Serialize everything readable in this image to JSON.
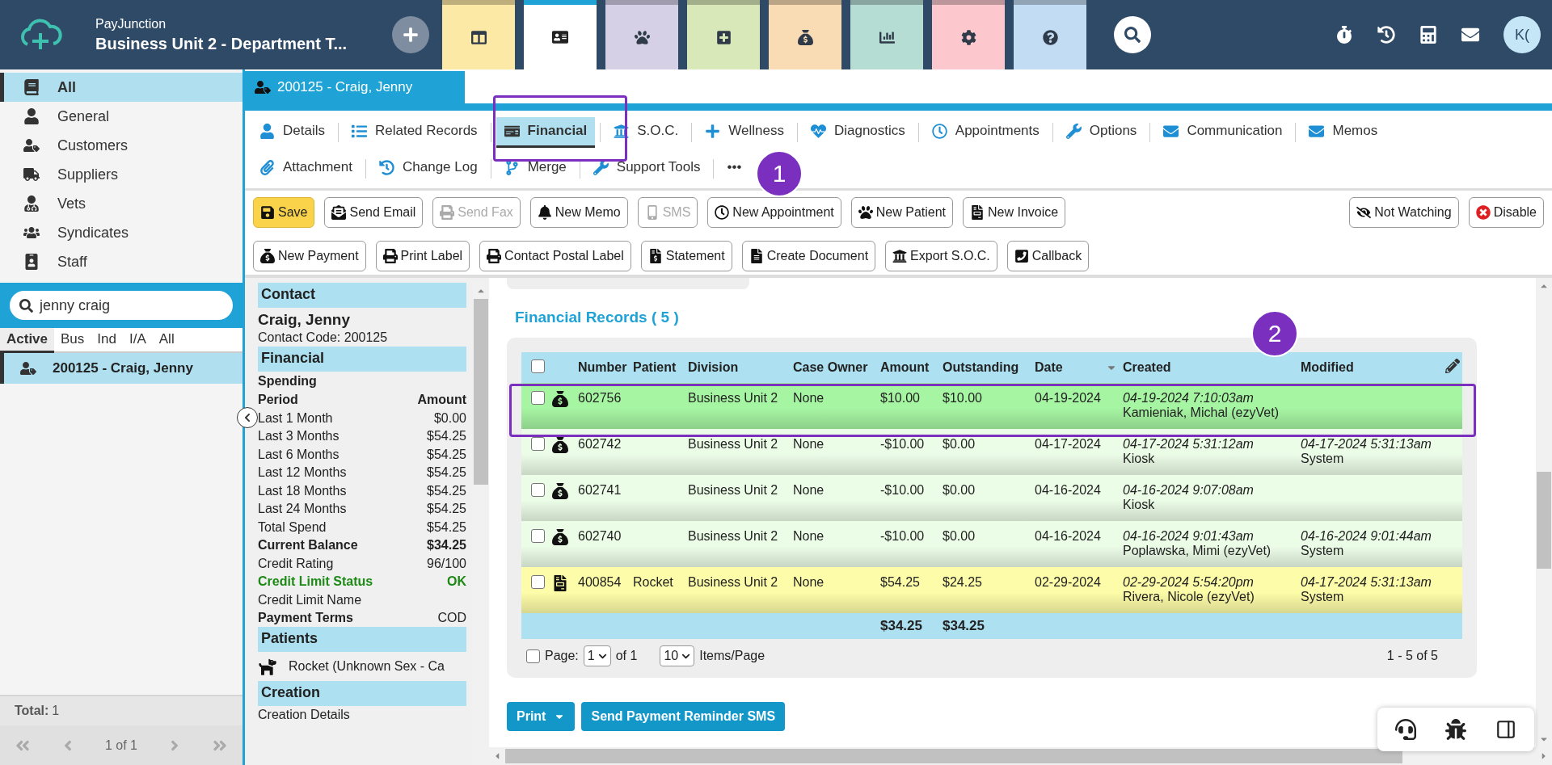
{
  "app": {
    "brand": "PayJunction",
    "title": "Business Unit 2 - Department T...",
    "avatar": "K("
  },
  "modules": [
    {
      "kind": "layout",
      "selected": false,
      "color": "#fde9a6"
    },
    {
      "kind": "contact",
      "selected": true,
      "color": "#ffffff"
    },
    {
      "kind": "paw",
      "selected": false,
      "color": "#d6d0e6"
    },
    {
      "kind": "add",
      "selected": false,
      "color": "#d9e8b8"
    },
    {
      "kind": "money",
      "selected": false,
      "color": "#fadcb4"
    },
    {
      "kind": "chart",
      "selected": false,
      "color": "#b5ddd4"
    },
    {
      "kind": "gear",
      "selected": false,
      "color": "#fcc8ce"
    },
    {
      "kind": "help",
      "selected": false,
      "color": "#c2dcf4"
    }
  ],
  "header_tools": [
    {
      "kind": "stopwatch"
    },
    {
      "kind": "history"
    },
    {
      "kind": "calculator"
    },
    {
      "kind": "mail"
    }
  ],
  "sidebar": {
    "items": [
      {
        "label": "All",
        "kind": "book",
        "selected": true
      },
      {
        "label": "General",
        "kind": "user",
        "selected": false
      },
      {
        "label": "Customers",
        "kind": "customer",
        "selected": false
      },
      {
        "label": "Suppliers",
        "kind": "supplier",
        "selected": false
      },
      {
        "label": "Vets",
        "kind": "vet",
        "selected": false
      },
      {
        "label": "Syndicates",
        "kind": "group",
        "selected": false
      },
      {
        "label": "Staff",
        "kind": "staff",
        "selected": false
      }
    ],
    "search": {
      "value": "jenny craig"
    },
    "filters": [
      {
        "label": "Active",
        "selected": true
      },
      {
        "label": "Bus",
        "selected": false
      },
      {
        "label": "Ind",
        "selected": false
      },
      {
        "label": "I/A",
        "selected": false
      },
      {
        "label": "All",
        "selected": false
      }
    ],
    "results": [
      {
        "label": "200125 - Craig, Jenny",
        "selected": true
      }
    ],
    "total_label": "Total:",
    "total": "1",
    "pager": "1 of 1"
  },
  "record_tab": {
    "label": "200125 - Craig, Jenny"
  },
  "subtab_rows": [
    [
      {
        "label": "Details",
        "kind": "details",
        "selected": false
      },
      {
        "label": "Related Records",
        "kind": "list",
        "selected": false
      },
      {
        "label": "Financial",
        "kind": "financial",
        "selected": true
      },
      {
        "label": "S.O.C.",
        "kind": "bank",
        "selected": false
      },
      {
        "label": "Wellness",
        "kind": "plus",
        "selected": false
      },
      {
        "label": "Diagnostics",
        "kind": "heart",
        "selected": false
      },
      {
        "label": "Appointments",
        "kind": "clock",
        "selected": false
      },
      {
        "label": "Options",
        "kind": "wrench",
        "selected": false
      },
      {
        "label": "Communication",
        "kind": "mail",
        "selected": false
      },
      {
        "label": "Memos",
        "kind": "mail",
        "selected": false
      }
    ],
    [
      {
        "label": "Attachment",
        "kind": "clip",
        "selected": false
      },
      {
        "label": "Change Log",
        "kind": "history",
        "selected": false
      },
      {
        "label": "Merge",
        "kind": "merge",
        "selected": false
      },
      {
        "label": "Support Tools",
        "kind": "wrench",
        "selected": false
      },
      {
        "label": "•••",
        "kind": "more",
        "selected": false
      }
    ]
  ],
  "toolbar_rows": [
    [
      {
        "label": "Save",
        "kind": "save",
        "disabled": false
      },
      {
        "label": "Send Email",
        "kind": "email",
        "disabled": false
      },
      {
        "label": "Send Fax",
        "kind": "fax",
        "disabled": true
      },
      {
        "label": "New Memo",
        "kind": "alarm",
        "disabled": false
      },
      {
        "label": "SMS",
        "kind": "sms",
        "disabled": true
      },
      {
        "label": "New Appointment",
        "kind": "clock",
        "disabled": false
      },
      {
        "label": "New Patient",
        "kind": "paw",
        "disabled": false
      },
      {
        "label": "New Invoice",
        "kind": "invoice",
        "disabled": false
      }
    ],
    [
      {
        "label": "New Payment",
        "kind": "payment",
        "disabled": false
      },
      {
        "label": "Print Label",
        "kind": "label",
        "disabled": false
      },
      {
        "label": "Contact Postal Label",
        "kind": "label",
        "disabled": false
      },
      {
        "label": "Statement",
        "kind": "statement",
        "disabled": false
      },
      {
        "label": "Create Document",
        "kind": "document",
        "disabled": false
      },
      {
        "label": "Export S.O.C.",
        "kind": "bank",
        "disabled": false
      },
      {
        "label": "Callback",
        "kind": "phone",
        "disabled": false
      }
    ]
  ],
  "toolbar_right": [
    {
      "label": "Not Watching",
      "kind": "eye",
      "disabled": false
    },
    {
      "label": "Disable",
      "kind": "disable",
      "disabled": false
    }
  ],
  "contact_panel": [
    {
      "title": "Contact",
      "items": [
        {
          "kind": "name",
          "label": "Craig, Jenny"
        },
        {
          "kind": "line",
          "label": "Contact Code: 200125"
        }
      ]
    },
    {
      "title": "Financial",
      "items": [
        {
          "kind": "heading",
          "label": "Spending"
        },
        {
          "kind": "bold",
          "label": "Period",
          "value": "Amount"
        },
        {
          "kind": "line",
          "label": "Last 1 Month",
          "value": "$0.00"
        },
        {
          "kind": "line",
          "label": "Last 3 Months",
          "value": "$54.25"
        },
        {
          "kind": "line",
          "label": "Last 6 Months",
          "value": "$54.25"
        },
        {
          "kind": "line",
          "label": "Last 12 Months",
          "value": "$54.25"
        },
        {
          "kind": "line",
          "label": "Last 18 Months",
          "value": "$54.25"
        },
        {
          "kind": "line",
          "label": "Last 24 Months",
          "value": "$54.25"
        },
        {
          "kind": "line",
          "label": "Total Spend",
          "value": "$54.25"
        },
        {
          "kind": "bold",
          "label": "Current Balance",
          "value": "$34.25"
        },
        {
          "kind": "line",
          "label": "Credit Rating",
          "value": "96/100"
        },
        {
          "kind": "status",
          "label": "Credit Limit Status",
          "value": "OK"
        },
        {
          "kind": "line",
          "label": "Credit Limit Name"
        },
        {
          "kind": "terms",
          "label": "Payment Terms",
          "value": "COD"
        }
      ]
    },
    {
      "title": "Patients",
      "items": [
        {
          "kind": "patient",
          "label": "Rocket (Unknown Sex - Ca"
        }
      ]
    },
    {
      "title": "Creation",
      "items": [
        {
          "kind": "line",
          "label": "Creation Details"
        }
      ]
    }
  ],
  "financial_records": {
    "title": "Financial Records ( 5 )",
    "select_all": {
      "checked": false
    },
    "columns": [
      {
        "label": "Number",
        "sorted": false
      },
      {
        "label": "Patient",
        "sorted": false
      },
      {
        "label": "Division",
        "sorted": false
      },
      {
        "label": "Case Owner",
        "sorted": false
      },
      {
        "label": "Amount",
        "sorted": false
      },
      {
        "label": "Outstanding",
        "sorted": false
      },
      {
        "label": "Date",
        "sorted": true
      },
      {
        "label": "Created",
        "sorted": false
      },
      {
        "label": "Modified",
        "sorted": false
      }
    ],
    "rows": [
      {
        "kind": "payment",
        "checked": false,
        "color": "#a6f5a2",
        "number": "602756",
        "division": "Business Unit 2",
        "case_owner": "None",
        "amount": "$10.00",
        "outstanding": "$10.00",
        "date": "04-19-2024",
        "created": "04-19-2024 7:10:03am",
        "created_by": "Kamieniak, Michal (ezyVet)"
      },
      {
        "kind": "payment",
        "checked": false,
        "color": "#ebfce7",
        "number": "602742",
        "division": "Business Unit 2",
        "case_owner": "None",
        "amount": "-$10.00",
        "outstanding": "$0.00",
        "date": "04-17-2024",
        "created": "04-17-2024 5:31:12am",
        "created_by": "Kiosk",
        "modified": "04-17-2024 5:31:13am",
        "modified_by": "System"
      },
      {
        "kind": "payment",
        "checked": false,
        "color": "#ebfce7",
        "number": "602741",
        "division": "Business Unit 2",
        "case_owner": "None",
        "amount": "-$10.00",
        "outstanding": "$0.00",
        "date": "04-16-2024",
        "created": "04-16-2024 9:07:08am",
        "created_by": "Kiosk"
      },
      {
        "kind": "payment",
        "checked": false,
        "color": "#ebfce7",
        "number": "602740",
        "division": "Business Unit 2",
        "case_owner": "None",
        "amount": "-$10.00",
        "outstanding": "$0.00",
        "date": "04-16-2024",
        "created": "04-16-2024 9:01:43am",
        "created_by": "Poplawska, Mimi (ezyVet)",
        "modified": "04-16-2024 9:01:44am",
        "modified_by": "System"
      },
      {
        "kind": "invoice",
        "checked": false,
        "color": "#fdfca8",
        "number": "400854",
        "patient": "Rocket",
        "division": "Business Unit 2",
        "case_owner": "None",
        "amount": "$54.25",
        "outstanding": "$24.25",
        "date": "02-29-2024",
        "created": "02-29-2024 5:54:20pm",
        "created_by": "Rivera, Nicole (ezyVet)",
        "modified": "04-17-2024 5:31:13am",
        "modified_by": "System"
      }
    ],
    "totals": {
      "amount": "$34.25",
      "outstanding": "$34.25"
    },
    "pager": {
      "checked": false,
      "page_label": "Page:",
      "page": "1",
      "of": "of 1",
      "per_page": "10",
      "per_page_label": "Items/Page",
      "range": "1 - 5 of 5"
    }
  },
  "actions": [
    {
      "label": "Print",
      "kind": "dropdown"
    },
    {
      "label": "Send Payment Reminder SMS",
      "kind": "button"
    }
  ],
  "corner_tools": [
    {
      "kind": "support"
    },
    {
      "kind": "bug"
    },
    {
      "kind": "panel"
    }
  ],
  "annotations": [
    {
      "label": "1"
    },
    {
      "label": "2"
    }
  ]
}
